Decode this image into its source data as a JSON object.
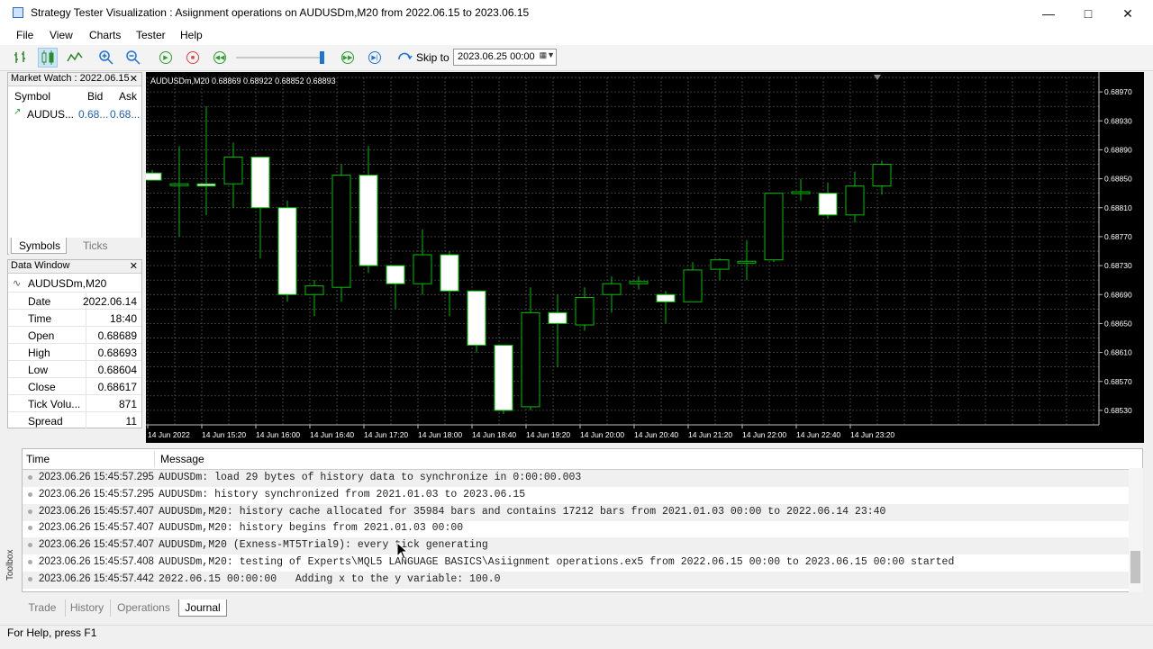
{
  "window": {
    "title": "Strategy Tester Visualization : Asiignment operations on AUDUSDm,M20 from 2022.06.15 to 2023.06.15"
  },
  "menu": [
    "File",
    "View",
    "Charts",
    "Tester",
    "Help"
  ],
  "toolbar": {
    "skip_label": "Skip to",
    "skip_value": "2023.06.25 00:00"
  },
  "market_watch": {
    "title": "Market Watch : 2022.06.15",
    "headers": [
      "Symbol",
      "Bid",
      "Ask"
    ],
    "rows": [
      {
        "symbol": "AUDUS...",
        "bid": "0.68...",
        "ask": "0.68..."
      }
    ],
    "tabs": [
      "Symbols",
      "Ticks"
    ]
  },
  "data_window": {
    "title": "Data Window",
    "symbol": "AUDUSDm,M20",
    "rows": [
      {
        "label": "Date",
        "value": "2022.06.14"
      },
      {
        "label": "Time",
        "value": "18:40"
      },
      {
        "label": "Open",
        "value": "0.68689"
      },
      {
        "label": "High",
        "value": "0.68693"
      },
      {
        "label": "Low",
        "value": "0.68604"
      },
      {
        "label": "Close",
        "value": "0.68617"
      },
      {
        "label": "Tick Volu...",
        "value": "871"
      },
      {
        "label": "Spread",
        "value": "11"
      }
    ]
  },
  "chart": {
    "header": "AUDUSDm,M20  0.68869 0.68922 0.68852 0.68893",
    "colors": {
      "background": "#000000",
      "grid": "#5a5a5a",
      "bull": "#000000",
      "bear": "#ffffff",
      "wick": "#00c000"
    },
    "x_labels": [
      "14 Jun 2022",
      "14 Jun 15:20",
      "14 Jun 16:00",
      "14 Jun 16:40",
      "14 Jun 17:20",
      "14 Jun 18:00",
      "14 Jun 18:40",
      "14 Jun 19:20",
      "14 Jun 20:00",
      "14 Jun 20:40",
      "14 Jun 21:20",
      "14 Jun 22:00",
      "14 Jun 22:40",
      "14 Jun 23:20"
    ],
    "y_labels": [
      "0.68970",
      "0.68930",
      "0.68890",
      "0.68850",
      "0.68810",
      "0.68770",
      "0.68730",
      "0.68690",
      "0.68650",
      "0.68610",
      "0.68570",
      "0.68530"
    ]
  },
  "chart_data": {
    "type": "candlestick",
    "ylim": [
      0.6851,
      0.6899
    ],
    "candles": [
      {
        "o": 0.68858,
        "h": 0.68862,
        "l": 0.68848,
        "c": 0.68848
      },
      {
        "o": 0.68843,
        "h": 0.68895,
        "l": 0.6877,
        "c": 0.68843
      },
      {
        "o": 0.68843,
        "h": 0.6895,
        "l": 0.688,
        "c": 0.6884
      },
      {
        "o": 0.68843,
        "h": 0.689,
        "l": 0.6881,
        "c": 0.6888
      },
      {
        "o": 0.6888,
        "h": 0.6888,
        "l": 0.6874,
        "c": 0.6881
      },
      {
        "o": 0.6881,
        "h": 0.6882,
        "l": 0.6868,
        "c": 0.6869
      },
      {
        "o": 0.6869,
        "h": 0.6871,
        "l": 0.6866,
        "c": 0.68702
      },
      {
        "o": 0.687,
        "h": 0.6887,
        "l": 0.6868,
        "c": 0.68855
      },
      {
        "o": 0.68855,
        "h": 0.68895,
        "l": 0.6872,
        "c": 0.6873
      },
      {
        "o": 0.6873,
        "h": 0.6873,
        "l": 0.6867,
        "c": 0.68705
      },
      {
        "o": 0.68705,
        "h": 0.6878,
        "l": 0.6869,
        "c": 0.68745
      },
      {
        "o": 0.68745,
        "h": 0.6875,
        "l": 0.6866,
        "c": 0.68695
      },
      {
        "o": 0.68695,
        "h": 0.68695,
        "l": 0.6861,
        "c": 0.6862
      },
      {
        "o": 0.6862,
        "h": 0.6862,
        "l": 0.68525,
        "c": 0.6853
      },
      {
        "o": 0.68535,
        "h": 0.687,
        "l": 0.6853,
        "c": 0.68665
      },
      {
        "o": 0.68665,
        "h": 0.6869,
        "l": 0.6859,
        "c": 0.6865
      },
      {
        "o": 0.68648,
        "h": 0.687,
        "l": 0.6864,
        "c": 0.68686
      },
      {
        "o": 0.6869,
        "h": 0.68715,
        "l": 0.68665,
        "c": 0.68705
      },
      {
        "o": 0.68705,
        "h": 0.68715,
        "l": 0.68697,
        "c": 0.68708
      },
      {
        "o": 0.6869,
        "h": 0.68695,
        "l": 0.6865,
        "c": 0.6868
      },
      {
        "o": 0.6868,
        "h": 0.68735,
        "l": 0.6868,
        "c": 0.68724
      },
      {
        "o": 0.68725,
        "h": 0.6874,
        "l": 0.6871,
        "c": 0.68738
      },
      {
        "o": 0.68736,
        "h": 0.68765,
        "l": 0.6871,
        "c": 0.68736
      },
      {
        "o": 0.68738,
        "h": 0.6883,
        "l": 0.68735,
        "c": 0.6883
      },
      {
        "o": 0.6883,
        "h": 0.6885,
        "l": 0.6882,
        "c": 0.68832
      },
      {
        "o": 0.6883,
        "h": 0.68845,
        "l": 0.68795,
        "c": 0.688
      },
      {
        "o": 0.688,
        "h": 0.6886,
        "l": 0.6879,
        "c": 0.6884
      },
      {
        "o": 0.6884,
        "h": 0.68875,
        "l": 0.68828,
        "c": 0.6887
      }
    ]
  },
  "journal": {
    "headers": [
      "Time",
      "Message"
    ],
    "rows": [
      {
        "time": "2023.06.26 15:45:57.295",
        "message": "AUDUSDm: load 29 bytes of history data to synchronize in 0:00:00.003"
      },
      {
        "time": "2023.06.26 15:45:57.295",
        "message": "AUDUSDm: history synchronized from 2021.01.03 to 2023.06.15"
      },
      {
        "time": "2023.06.26 15:45:57.407",
        "message": "AUDUSDm,M20: history cache allocated for 35984 bars and contains 17212 bars from 2021.01.03 00:00 to 2022.06.14 23:40"
      },
      {
        "time": "2023.06.26 15:45:57.407",
        "message": "AUDUSDm,M20: history begins from 2021.01.03 00:00"
      },
      {
        "time": "2023.06.26 15:45:57.407",
        "message": "AUDUSDm,M20 (Exness-MT5Trial9): every tick generating"
      },
      {
        "time": "2023.06.26 15:45:57.408",
        "message": "AUDUSDm,M20: testing of Experts\\MQL5 LANGUAGE BASICS\\Asiignment operations.ex5 from 2022.06.15 00:00 to 2023.06.15 00:00 started"
      },
      {
        "time": "2023.06.26 15:45:57.442",
        "message": "2022.06.15 00:00:00   Adding x to the y variable: 100.0"
      }
    ]
  },
  "toolbox_label": "Toolbox",
  "bottom_tabs": [
    "Trade",
    "History",
    "Operations",
    "Journal"
  ],
  "status": "For Help, press F1"
}
